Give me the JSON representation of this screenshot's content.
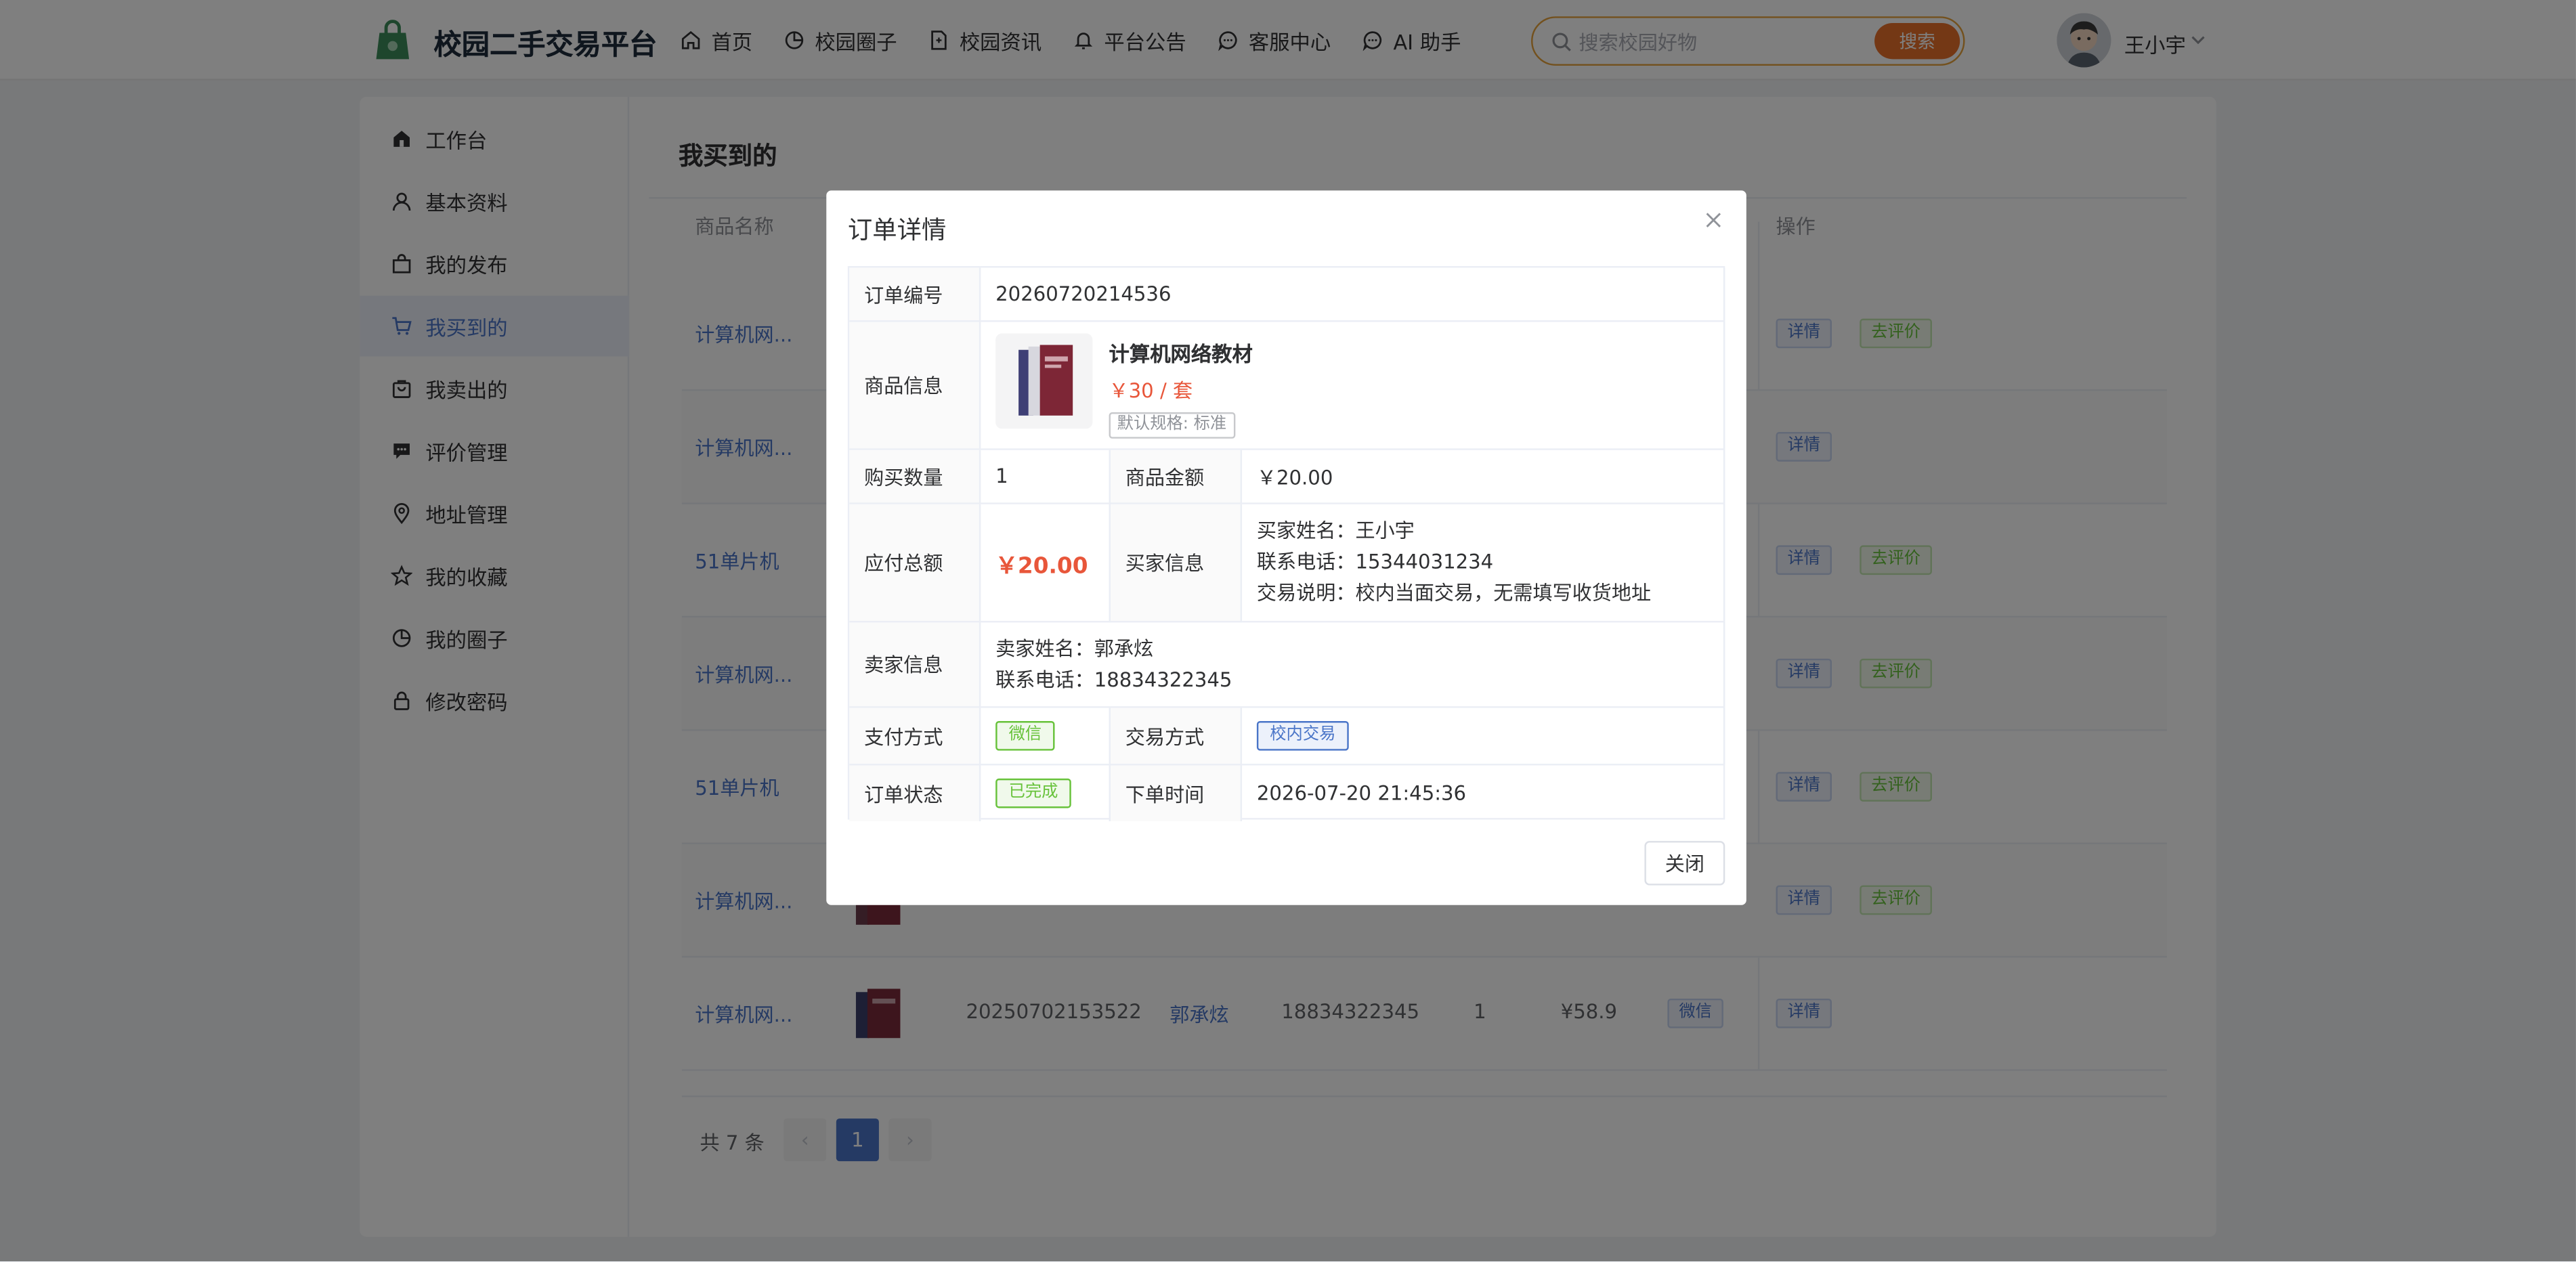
{
  "header": {
    "logo_text": "校园二手交易平台",
    "nav": [
      {
        "label": "首页",
        "icon": "home-icon"
      },
      {
        "label": "校园圈子",
        "icon": "pie-icon"
      },
      {
        "label": "校园资讯",
        "icon": "document-icon"
      },
      {
        "label": "平台公告",
        "icon": "bell-icon"
      },
      {
        "label": "客服中心",
        "icon": "chat-icon"
      },
      {
        "label": "AI 助手",
        "icon": "chat-icon"
      }
    ],
    "search_placeholder": "搜索校园好物",
    "search_button": "搜索",
    "username": "王小宇"
  },
  "sidebar": {
    "items": [
      {
        "label": "工作台",
        "icon": "home-icon"
      },
      {
        "label": "基本资料",
        "icon": "user-icon"
      },
      {
        "label": "我的发布",
        "icon": "bag-icon"
      },
      {
        "label": "我买到的",
        "icon": "cart-icon",
        "active": true
      },
      {
        "label": "我卖出的",
        "icon": "shop-icon"
      },
      {
        "label": "评价管理",
        "icon": "comment-icon"
      },
      {
        "label": "地址管理",
        "icon": "location-icon"
      },
      {
        "label": "我的收藏",
        "icon": "star-icon"
      },
      {
        "label": "我的圈子",
        "icon": "pie-icon"
      },
      {
        "label": "修改密码",
        "icon": "lock-icon"
      }
    ]
  },
  "page": {
    "title": "我买到的",
    "columns": {
      "name": "商品名称",
      "actions": "操作"
    },
    "rows": [
      {
        "name": "计算机网...",
        "actions": [
          "详情",
          "去评价"
        ]
      },
      {
        "name": "计算机网...",
        "actions": [
          "详情"
        ]
      },
      {
        "name": "51单片机",
        "actions": [
          "详情",
          "去评价"
        ]
      },
      {
        "name": "计算机网...",
        "actions": [
          "详情",
          "去评价"
        ]
      },
      {
        "name": "51单片机",
        "actions": [
          "详情",
          "去评价"
        ]
      },
      {
        "name": "计算机网...",
        "actions": [
          "详情",
          "去评价"
        ]
      },
      {
        "name": "计算机网...",
        "order_no": "20250702153522",
        "seller": "郭承炫",
        "phone": "18834322345",
        "qty": "1",
        "amount": "¥58.9",
        "pay": "微信",
        "actions": [
          "详情"
        ]
      }
    ],
    "pagination": {
      "total": "共 7 条",
      "prev": "‹",
      "current": "1",
      "next": "›"
    }
  },
  "dialog": {
    "title": "订单详情",
    "labels": {
      "order_no": "订单编号",
      "product_info": "商品信息",
      "quantity": "购买数量",
      "product_amount": "商品金额",
      "total": "应付总额",
      "buyer_info": "买家信息",
      "seller_info": "卖家信息",
      "pay_method": "支付方式",
      "trade_method": "交易方式",
      "status": "订单状态",
      "order_time": "下单时间"
    },
    "order_no": "20260720214536",
    "product": {
      "name": "计算机网络教材",
      "price": "￥30 / 套",
      "spec": "默认规格: 标准"
    },
    "quantity": "1",
    "product_amount": "￥20.00",
    "total": "￥20.00",
    "buyer": {
      "name": "买家姓名：王小宇",
      "phone": "联系电话：15344031234",
      "note": "交易说明：校内当面交易，无需填写收货地址"
    },
    "seller": {
      "name": "卖家姓名：郭承炫",
      "phone": "联系电话：18834322345"
    },
    "pay_method": "微信",
    "trade_method": "校内交易",
    "status": "已完成",
    "order_time": "2026-07-20 21:45:36",
    "close_button": "关闭"
  }
}
